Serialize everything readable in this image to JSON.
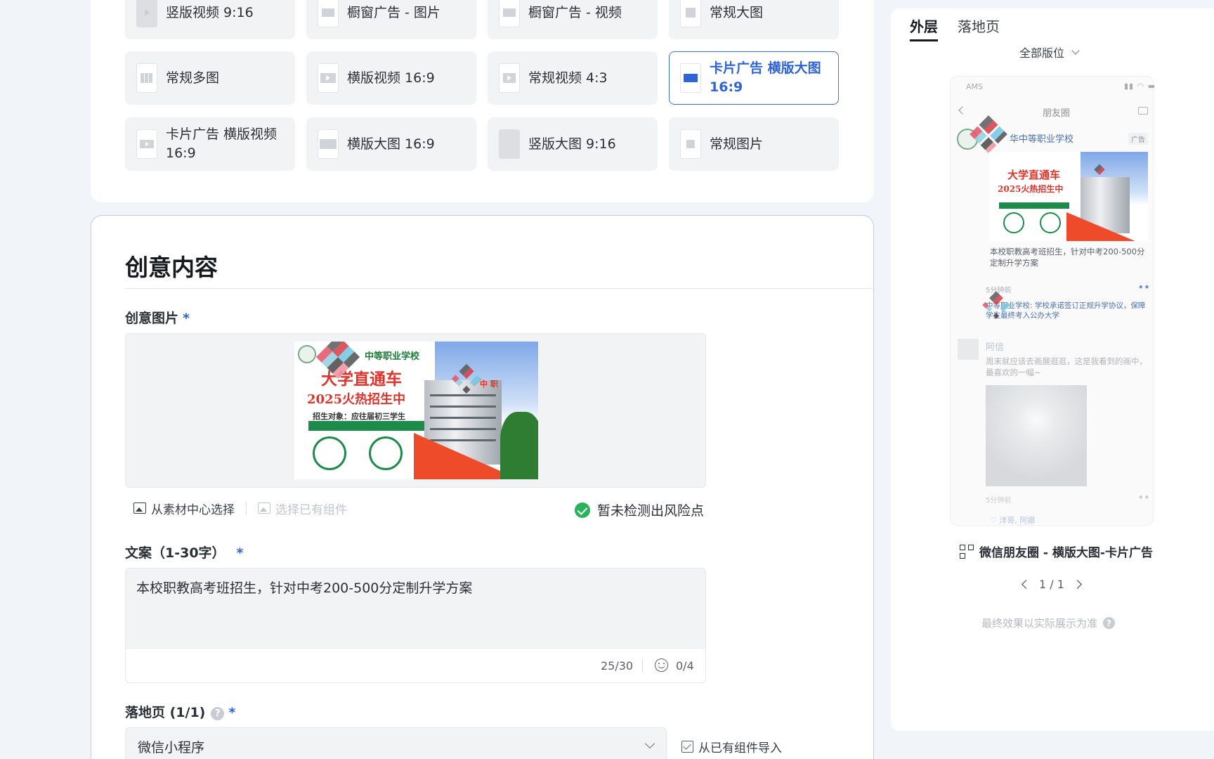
{
  "formats": [
    {
      "label": "竖版视频 9:16",
      "selected": false
    },
    {
      "label": "橱窗广告 - 图片",
      "selected": false
    },
    {
      "label": "橱窗广告 - 视频",
      "selected": false
    },
    {
      "label": "常规大图",
      "selected": false
    },
    {
      "label": "常规多图",
      "selected": false
    },
    {
      "label": "横版视频 16:9",
      "selected": false
    },
    {
      "label": "常规视频  4:3",
      "selected": false
    },
    {
      "label": "卡片广告 横版大图 16:9",
      "selected": true
    },
    {
      "label": "卡片广告 横版视频 16:9",
      "selected": false
    },
    {
      "label": "横版大图 16:9",
      "selected": false
    },
    {
      "label": "竖版大图 9:16",
      "selected": false
    },
    {
      "label": "常规图片",
      "selected": false
    }
  ],
  "creative": {
    "title": "创意内容",
    "image_label": "创意图片",
    "required_mark": "*",
    "image": {
      "school": "中等职业学校",
      "headline": "大学直通车",
      "subheadline": "2025火热招生中",
      "line": "招生对象：应往届初三学生",
      "badge": "中 职"
    },
    "actions": {
      "material_center": "从素材中心选择",
      "existing_component": "选择已有组件"
    },
    "risk_status": "暂未检测出风险点",
    "copy_label": "文案（1-30字）",
    "copy_value": "本校职教高考班招生，针对中考200-500分定制升学方案",
    "char_count": "25/30",
    "emoji_count": "0/4",
    "landing_label": "落地页 (1/1)",
    "landing_value": "微信小程序",
    "import_label": "从已有组件导入"
  },
  "preview": {
    "tabs": [
      "外层",
      "落地页"
    ],
    "active_tab": "外层",
    "placement": "全部版位",
    "phone": {
      "carrier": "AMS",
      "header": "朋友圈",
      "account": "华中等职业学校",
      "ad_tag": "广告",
      "ad_text": "本校职教高考班招生，针对中考200-500分定制升学方案",
      "time1": "5分钟前",
      "comment": "中等职业学校: 学校承诺签订正规升学协议，保障学生最终考入公办大学",
      "friend_name": "阿信",
      "friend_text": "周末就应该去画展逛逛，这是我看到的画中，最喜欢的一幅~",
      "time2": "5分钟前",
      "likes": "♡ 洋哥, 阿娜"
    },
    "caption": "微信朋友圈 - 横版大图-卡片广告",
    "pager": "1 / 1",
    "disclaimer": "最终效果以实际展示为准"
  },
  "colors": {
    "accent": "#2f63d8",
    "success": "#29b35c",
    "page_bg": "#f1f4f9"
  }
}
